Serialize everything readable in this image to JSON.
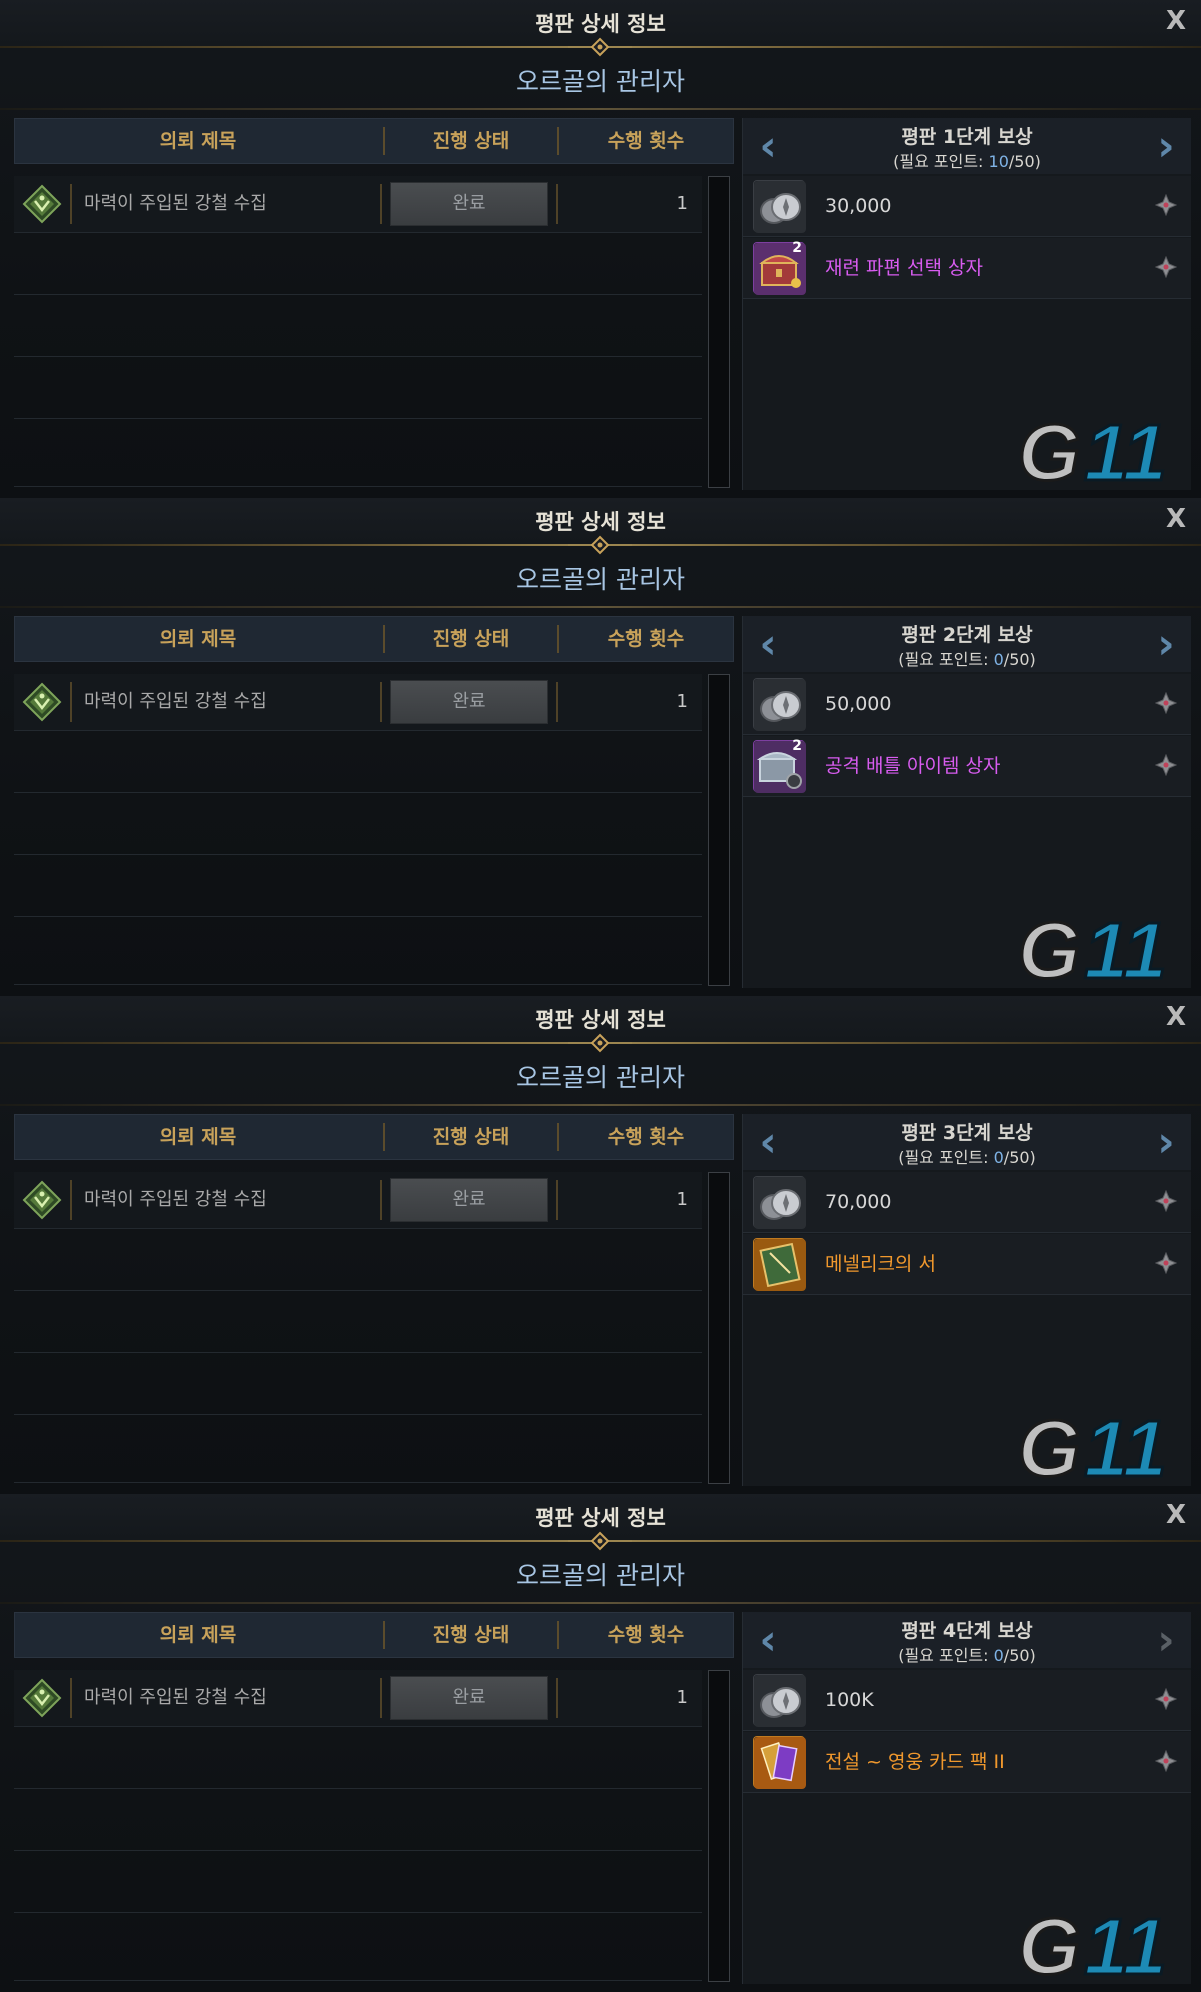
{
  "panels": [
    {
      "header_title": "평판 상세 정보",
      "close_label": "X",
      "npc_name": "오르골의 관리자",
      "columns": {
        "title": "의뢰 제목",
        "status": "진행 상태",
        "count": "수행 횟수"
      },
      "quest": {
        "name": "마력이 주입된 강철 수집",
        "status_button": "완료",
        "count": "1"
      },
      "reward_title": "평판 1단계 보상",
      "points_prefix": "(필요 포인트: ",
      "points_current": "10",
      "points_total": "/50)",
      "rewards": [
        {
          "name": "30,000",
          "style": "plain",
          "icon": "silver-coins-icon",
          "qty": ""
        },
        {
          "name": "재련 파편 선택 상자",
          "style": "purple",
          "icon": "treasure-chest-icon",
          "qty": "2"
        }
      ],
      "next_enabled": true
    },
    {
      "header_title": "평판 상세 정보",
      "close_label": "X",
      "npc_name": "오르골의 관리자",
      "columns": {
        "title": "의뢰 제목",
        "status": "진행 상태",
        "count": "수행 횟수"
      },
      "quest": {
        "name": "마력이 주입된 강철 수집",
        "status_button": "완료",
        "count": "1"
      },
      "reward_title": "평판 2단계 보상",
      "points_prefix": "(필요 포인트: ",
      "points_current": "0",
      "points_total": "/50)",
      "rewards": [
        {
          "name": "50,000",
          "style": "plain",
          "icon": "silver-coins-icon",
          "qty": ""
        },
        {
          "name": "공격 배틀 아이템 상자",
          "style": "purple",
          "icon": "battle-item-chest-icon",
          "qty": "2"
        }
      ],
      "next_enabled": true
    },
    {
      "header_title": "평판 상세 정보",
      "close_label": "X",
      "npc_name": "오르골의 관리자",
      "columns": {
        "title": "의뢰 제목",
        "status": "진행 상태",
        "count": "수행 횟수"
      },
      "quest": {
        "name": "마력이 주입된 강철 수집",
        "status_button": "완료",
        "count": "1"
      },
      "reward_title": "평판 3단계 보상",
      "points_prefix": "(필요 포인트: ",
      "points_current": "0",
      "points_total": "/50)",
      "rewards": [
        {
          "name": "70,000",
          "style": "plain",
          "icon": "silver-coins-icon",
          "qty": ""
        },
        {
          "name": "메넬리크의 서",
          "style": "orange",
          "icon": "book-icon",
          "qty": ""
        }
      ],
      "next_enabled": true
    },
    {
      "header_title": "평판 상세 정보",
      "close_label": "X",
      "npc_name": "오르골의 관리자",
      "columns": {
        "title": "의뢰 제목",
        "status": "진행 상태",
        "count": "수행 횟수"
      },
      "quest": {
        "name": "마력이 주입된 강철 수집",
        "status_button": "완료",
        "count": "1"
      },
      "reward_title": "평판 4단계 보상",
      "points_prefix": "(필요 포인트: ",
      "points_current": "0",
      "points_total": "/50)",
      "rewards": [
        {
          "name": "100K",
          "style": "plain",
          "icon": "silver-coins-icon",
          "qty": ""
        },
        {
          "name": "전설 ~ 영웅 카드 팩 II",
          "style": "orange",
          "icon": "card-pack-icon",
          "qty": ""
        }
      ],
      "next_enabled": false
    }
  ],
  "watermark": "G11",
  "colors": {
    "accent_gold": "#c8a25a",
    "npc_blue": "#a8c6e4",
    "purple_item": "#d85cf0",
    "orange_item": "#f0982d"
  }
}
